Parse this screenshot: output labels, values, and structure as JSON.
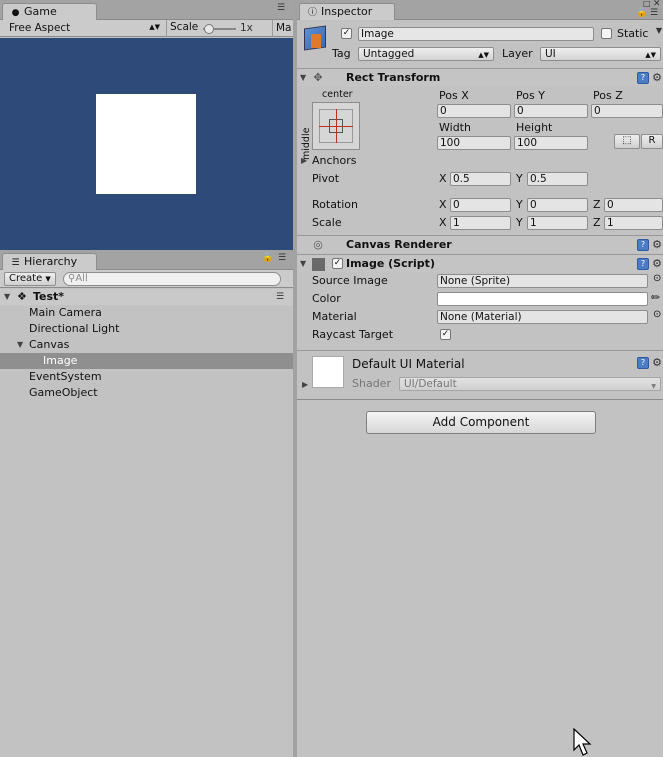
{
  "game": {
    "tab_label": "Game",
    "aspect": "Free Aspect",
    "scale_label": "Scale",
    "scale_value": "1x",
    "maximize_label": "Ma"
  },
  "hierarchy": {
    "tab_label": "Hierarchy",
    "create_label": "Create",
    "search_placeholder": "All",
    "scene_name": "Test*",
    "items": [
      {
        "label": "Main Camera"
      },
      {
        "label": "Directional Light"
      },
      {
        "label": "Canvas"
      },
      {
        "label": "Image"
      },
      {
        "label": "EventSystem"
      },
      {
        "label": "GameObject"
      }
    ]
  },
  "inspector": {
    "tab_label": "Inspector",
    "object_name": "Image",
    "active": true,
    "static_label": "Static",
    "tag_label": "Tag",
    "tag_value": "Untagged",
    "layer_label": "Layer",
    "layer_value": "UI",
    "rect_transform": {
      "title": "Rect Transform",
      "anchor_h": "center",
      "anchor_v": "middle",
      "pos_x_label": "Pos X",
      "pos_y_label": "Pos Y",
      "pos_z_label": "Pos Z",
      "pos_x": "0",
      "pos_y": "0",
      "pos_z": "0",
      "width_label": "Width",
      "height_label": "Height",
      "width": "100",
      "height": "100",
      "blueprint_btn": "R",
      "anchors_label": "Anchors",
      "pivot_label": "Pivot",
      "pivot_x": "0.5",
      "pivot_y": "0.5",
      "rotation_label": "Rotation",
      "rot_x": "0",
      "rot_y": "0",
      "rot_z": "0",
      "scale_label": "Scale",
      "scale_x": "1",
      "scale_y": "1",
      "scale_z": "1",
      "x": "X",
      "y": "Y",
      "z": "Z"
    },
    "canvas_renderer": {
      "title": "Canvas Renderer"
    },
    "image_script": {
      "title": "Image (Script)",
      "source_image_label": "Source Image",
      "source_image_value": "None (Sprite)",
      "color_label": "Color",
      "color_value": "#ffffff",
      "material_label": "Material",
      "material_value": "None (Material)",
      "raycast_label": "Raycast Target",
      "raycast": true
    },
    "material_block": {
      "title": "Default UI Material",
      "shader_label": "Shader",
      "shader_value": "UI/Default"
    },
    "add_component": "Add Component"
  }
}
